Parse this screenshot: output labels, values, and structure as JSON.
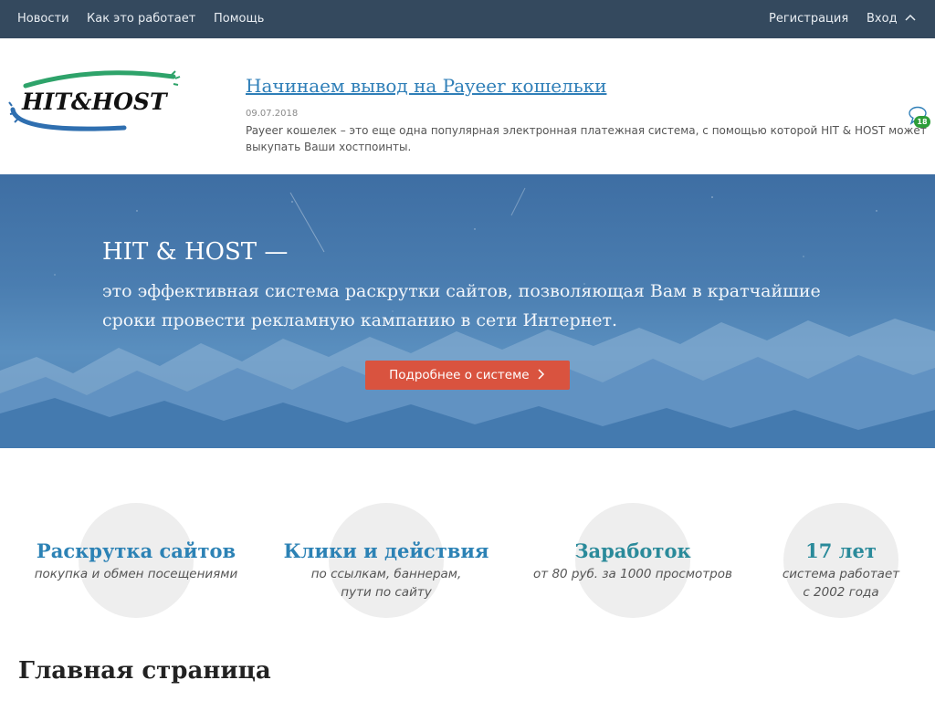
{
  "nav": {
    "news": "Новости",
    "how_it_works": "Как это работает",
    "help": "Помощь",
    "register": "Регистрация",
    "login": "Вход"
  },
  "logo": {
    "text": "HIT&HOST"
  },
  "news": {
    "title": "Начинаем вывод на Payeer кошельки",
    "date": "09.07.2018",
    "text": "Payeer кошелек – это еще одна популярная электронная платежная система, с помощью которой HIT & HOST может выкупать Ваши хостпоинты.",
    "comment_count": "18"
  },
  "hero": {
    "title": "HIT & HOST —",
    "subtitle": "это эффективная система раскрутки сайтов, позволяющая Вам в кратчайшие сроки провести рекламную кампанию в сети Интернет.",
    "button": "Подробнее о системе"
  },
  "features": [
    {
      "title": "Раскрутка сайтов",
      "desc": "покупка и обмен посещениями",
      "color": "#2c82b5"
    },
    {
      "title": "Клики и действия",
      "desc": "по ссылкам, баннерам,\nпути по сайту",
      "color": "#2c82b5"
    },
    {
      "title": "Заработок",
      "desc": "от 80 руб. за 1000 просмотров",
      "color": "#2a8a9a"
    },
    {
      "title": "17 лет",
      "desc": "система работает\nс 2002 года",
      "color": "#2a8a9a"
    }
  ],
  "main": {
    "heading": "Главная страница"
  },
  "colors": {
    "nav_bg": "#34495e",
    "link": "#2f7fb8",
    "button": "#d9533f",
    "badge": "#2e9e3a"
  }
}
